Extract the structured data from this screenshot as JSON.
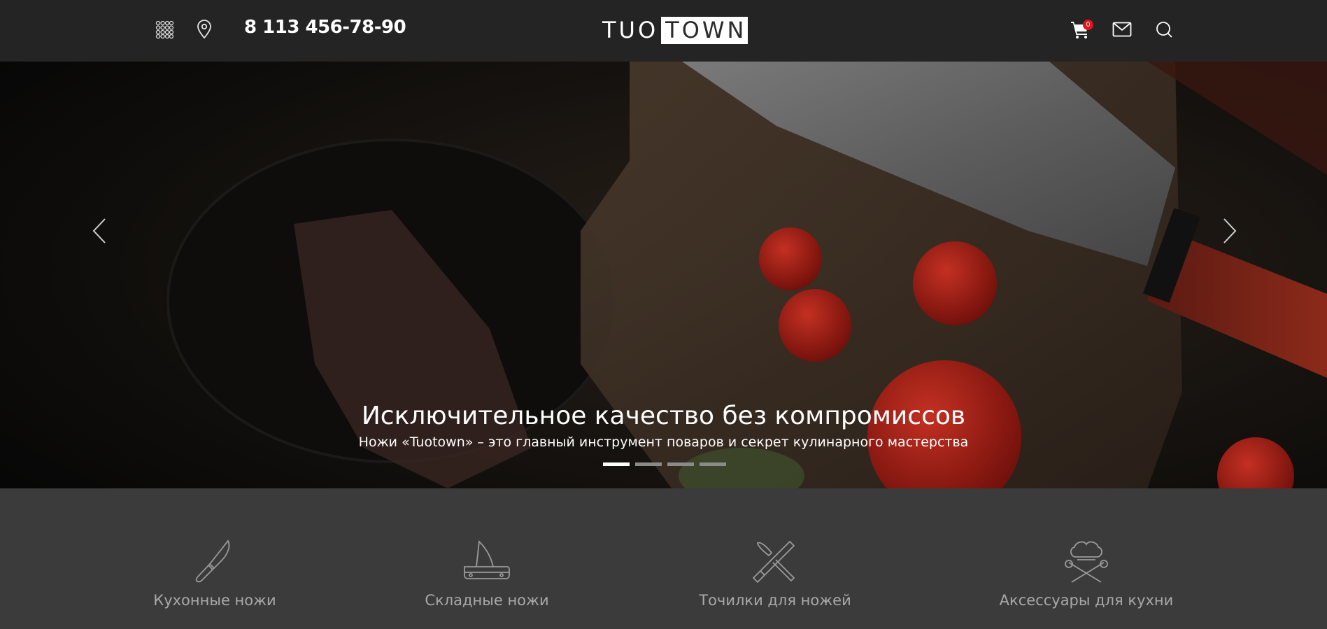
{
  "header": {
    "phone": "8 113 456-78-90",
    "logo_left": "TUO",
    "logo_right": "TOWN",
    "cart_count": "0",
    "icons": [
      "grid-icon",
      "location-pin-icon",
      "cart-icon",
      "mail-icon",
      "search-icon"
    ]
  },
  "hero": {
    "title": "Исключительное качество без компромиссов",
    "subtitle": "Ножи «Tuotown» – это главный инструмент поваров и секрет кулинарного мастерства",
    "slides_total": 4,
    "active_slide": 1
  },
  "categories": [
    {
      "label": "Кухонные ножи",
      "icon": "kitchen-knife-icon"
    },
    {
      "label": "Складные ножи",
      "icon": "folding-knife-icon"
    },
    {
      "label": "Точилки для ножей",
      "icon": "knife-sharpener-icon"
    },
    {
      "label": "Аксессуары для кухни",
      "icon": "chef-hat-icon"
    }
  ],
  "colors": {
    "header_bg": "#262626",
    "categories_bg": "#3b3b3b",
    "badge": "#e2141c",
    "category_text": "#a8a8a8"
  }
}
